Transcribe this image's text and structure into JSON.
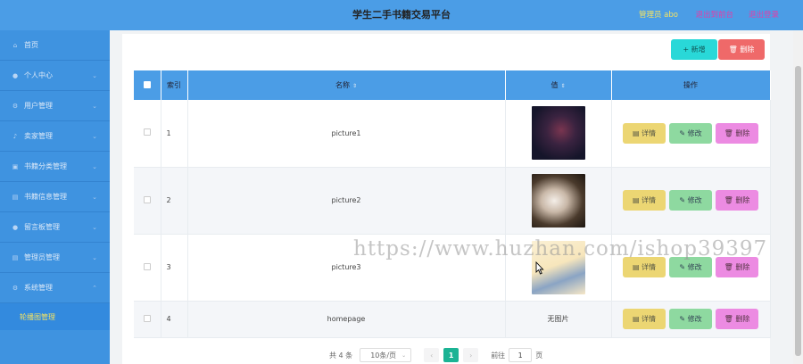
{
  "header": {
    "title": "学生二手书籍交易平台",
    "admin": "管理员 abo",
    "reset": "退出到前台",
    "logout": "退出登录"
  },
  "sidebar": {
    "items": [
      {
        "label": "首页",
        "icon": "home-icon"
      },
      {
        "label": "个人中心",
        "icon": "user-icon"
      },
      {
        "label": "用户管理",
        "icon": "gear-icon"
      },
      {
        "label": "卖家管理",
        "icon": "bell-icon"
      },
      {
        "label": "书籍分类管理",
        "icon": "book-icon"
      },
      {
        "label": "书籍信息管理",
        "icon": "list-icon"
      },
      {
        "label": "留言板管理",
        "icon": "user-icon"
      },
      {
        "label": "管理员管理",
        "icon": "list-icon"
      },
      {
        "label": "系统管理",
        "icon": "gear-icon"
      }
    ],
    "sub_item": "轮播图管理"
  },
  "toolbar": {
    "add_label": "+ 新增",
    "delete_label": "🗑 删除"
  },
  "table": {
    "headers": {
      "index": "索引",
      "name": "名称",
      "value": "值",
      "action": "操作"
    },
    "rows": [
      {
        "index": "1",
        "name": "picture1",
        "value": "",
        "image": "dark"
      },
      {
        "index": "2",
        "name": "picture2",
        "value": "",
        "image": "books"
      },
      {
        "index": "3",
        "name": "picture3",
        "value": "",
        "image": "light"
      },
      {
        "index": "4",
        "name": "homepage",
        "value": "无图片",
        "image": "none"
      }
    ],
    "actions": {
      "detail": "详情",
      "edit": "修改",
      "delete": "删除"
    }
  },
  "pagination": {
    "total": "共 4 条",
    "page_size": "10条/页",
    "prev": "‹",
    "current": "1",
    "next": "›",
    "goto_prefix": "前往",
    "goto_value": "1",
    "goto_suffix": "页"
  },
  "watermark": "https://www.huzhan.com/ishop39397",
  "colors": {
    "header": "#4b9de6",
    "sidebar": "#3f93e0",
    "add": "#29d8d8",
    "delete": "#ef6969",
    "active_page": "#1bb394"
  }
}
